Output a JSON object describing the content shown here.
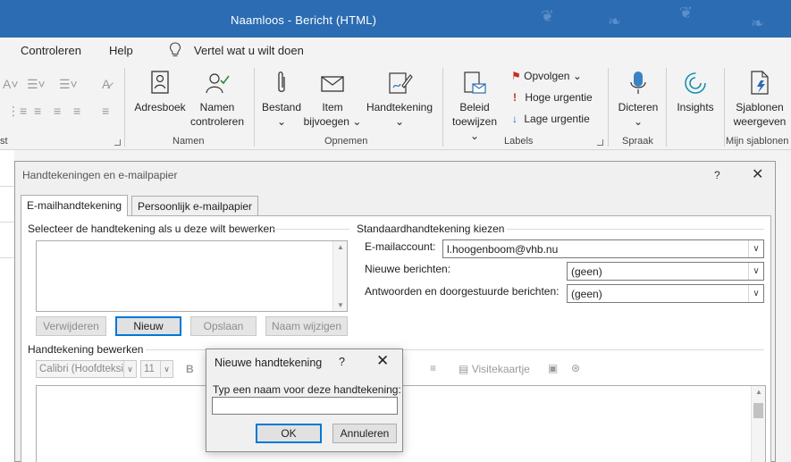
{
  "window": {
    "title": "Naamloos  -  Bericht (HTML)"
  },
  "menu": {
    "items": [
      "Controleren",
      "Help"
    ],
    "tell_me": "Vertel wat u wilt doen"
  },
  "ribbon": {
    "names_group": {
      "label": "Namen",
      "address_book": "Adresboek",
      "check_names_1": "Namen",
      "check_names_2": "controleren"
    },
    "include_group": {
      "label": "Opnemen",
      "attach_1": "Bestand",
      "attach_2": "⌄",
      "item_1": "Item",
      "item_2": "bijvoegen ⌄",
      "signature_1": "Handtekening",
      "signature_2": "⌄"
    },
    "tags_group": {
      "label": "Labels",
      "policy_1": "Beleid",
      "policy_2": "toewijzen ⌄",
      "follow_up": "Opvolgen ⌄",
      "high": "Hoge urgentie",
      "low": "Lage urgentie"
    },
    "voice_group": {
      "label": "Spraak",
      "dictate_1": "Dicteren",
      "dictate_2": "⌄"
    },
    "insights": "Insights",
    "templates_group": {
      "label": "Mijn sjablonen",
      "view_1": "Sjablonen",
      "view_2": "weergeven"
    },
    "left_group_label": "st"
  },
  "dialog": {
    "title": "Handtekeningen en e-mailpapier",
    "help": "?",
    "close": "✕",
    "tabs": [
      "E-mailhandtekening",
      "Persoonlijk e-mailpapier"
    ],
    "select_heading": "Selecteer de handtekening als u deze wilt bewerken",
    "buttons": {
      "delete": "Verwijderen",
      "new": "Nieuw",
      "save": "Opslaan",
      "rename": "Naam wijzigen"
    },
    "defaults_heading": "Standaardhandtekening kiezen",
    "account_label": "E-mailaccount:",
    "account_value": "l.hoogenboom@vhb.nu",
    "new_messages_label": "Nieuwe berichten:",
    "new_messages_value": "(geen)",
    "replies_label": "Antwoorden en doorgestuurde berichten:",
    "replies_value": "(geen)",
    "edit_heading": "Handtekening bewerken",
    "font_value": "Calibri (Hoofdteksi",
    "size_value": "11",
    "bold": "B",
    "business_card": "Visitekaartje"
  },
  "popup": {
    "title": "Nieuwe handtekening",
    "help": "?",
    "close": "✕",
    "prompt": "Typ een naam voor deze handtekening:",
    "input_value": "",
    "ok": "OK",
    "cancel": "Annuleren"
  }
}
